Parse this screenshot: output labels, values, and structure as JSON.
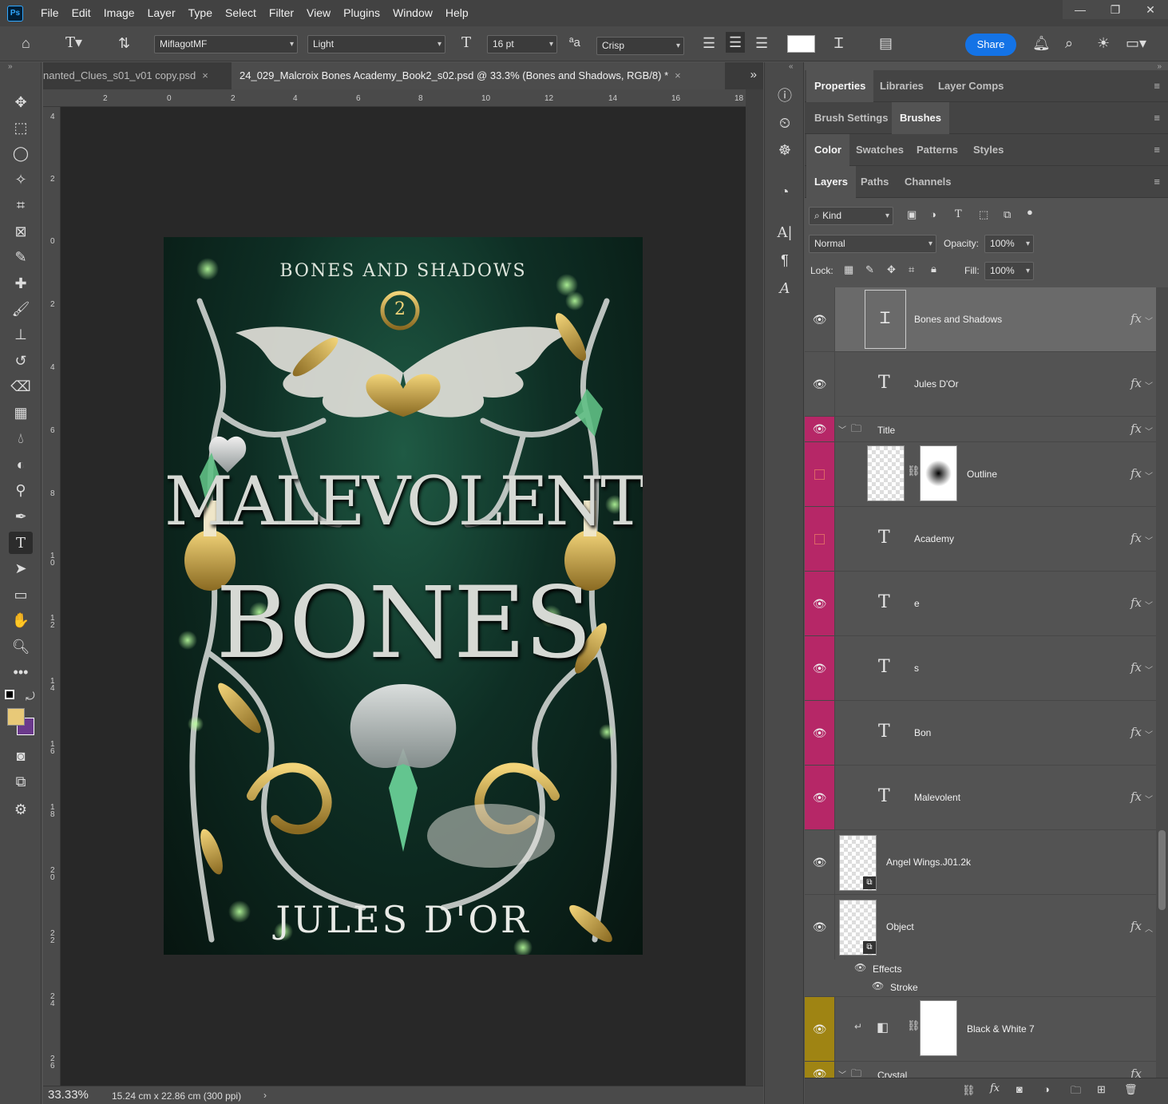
{
  "menu": [
    "File",
    "Edit",
    "Image",
    "Layer",
    "Type",
    "Select",
    "Filter",
    "View",
    "Plugins",
    "Window",
    "Help"
  ],
  "app_logo": "Ps",
  "window_controls": {
    "minimize": "—",
    "restore": "❐",
    "close": "✕"
  },
  "options": {
    "font_family": "MiflagotMF",
    "font_style": "Light",
    "font_size": "16 pt",
    "aa_label": "ªa",
    "antialias": "Crisp",
    "share": "Share"
  },
  "tabs": [
    {
      "label": "nanted_Clues_s01_v01 copy.psd",
      "close": "×"
    },
    {
      "label": "24_029_Malcroix Bones Academy_Book2_s02.psd @ 33.3% (Bones and Shadows, RGB/8) *",
      "close": "×"
    }
  ],
  "ruler_h": [
    "2",
    "0",
    "2",
    "4",
    "6",
    "8",
    "10",
    "12",
    "14",
    "16",
    "18"
  ],
  "ruler_v": [
    "4",
    "2",
    "0",
    "2",
    "4",
    "6",
    "8",
    "10",
    "12",
    "14",
    "16",
    "18",
    "20",
    "22",
    "24",
    "26"
  ],
  "status": {
    "zoom": "33.33%",
    "doc_size": "15.24 cm x 22.86 cm (300 ppi)",
    "arrow": "›"
  },
  "cover": {
    "series": "BONES AND SHADOWS",
    "book_number": "2",
    "title_line1": "MALEVOLENT",
    "title_line2": "BONES",
    "author": "JULES D'OR"
  },
  "panel_tabs": {
    "row1": [
      "Properties",
      "Libraries",
      "Layer Comps"
    ],
    "row2": [
      "Brush Settings",
      "Brushes"
    ],
    "row3": [
      "Color",
      "Swatches",
      "Patterns",
      "Styles"
    ],
    "row4": [
      "Layers",
      "Paths",
      "Channels"
    ]
  },
  "layers_controls": {
    "kind": "Kind",
    "blend_mode": "Normal",
    "opacity_label": "Opacity:",
    "opacity": "100%",
    "lock_label": "Lock:",
    "fill_label": "Fill:",
    "fill": "100%"
  },
  "layers": [
    {
      "name": "Bones and Shadows",
      "fx": "fx"
    },
    {
      "name": "Jules D'Or",
      "fx": "fx"
    },
    {
      "name": "Title",
      "fx": "fx"
    },
    {
      "name": "Outline",
      "fx": "fx"
    },
    {
      "name": "Academy",
      "fx": "fx"
    },
    {
      "name": "e",
      "fx": "fx"
    },
    {
      "name": "s",
      "fx": "fx"
    },
    {
      "name": "Bon",
      "fx": "fx"
    },
    {
      "name": "Malevolent",
      "fx": "fx"
    },
    {
      "name": "Angel Wings.J01.2k"
    },
    {
      "name": "Object",
      "fx": "fx"
    },
    {
      "name": "Black & White 7"
    },
    {
      "name": "Crystal",
      "fx": "fx"
    }
  ],
  "effects": {
    "label": "Effects",
    "stroke": "Stroke"
  },
  "colors": {
    "accent": "#1473e6",
    "label_pink": "#b62767",
    "label_yellow": "#9f8413",
    "fg_color": "#e8c978",
    "bg_color": "#6b3a8c"
  }
}
